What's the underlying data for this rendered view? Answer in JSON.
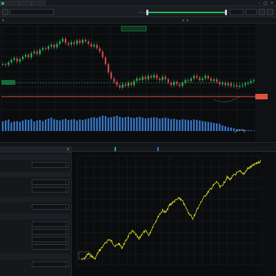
{
  "colors": {
    "background": "#0b0d10",
    "panel": "#15181b",
    "accent_green": "#1fbf5a",
    "accent_blue": "#2f7fd6",
    "candle_up": "#1fbf5a",
    "candle_down": "#d64b4b",
    "volume": "#3a78c9",
    "price_line": "#d9533f",
    "equity_line": "#e6df1f"
  },
  "icons": {
    "app": "app-logo-icon",
    "toolbar_left": "refresh-icon",
    "toolbar_right": [
      "settings-icon",
      "layout-icon",
      "close-icon"
    ],
    "panel_close": "close-icon"
  },
  "tabs": [
    {
      "label": "",
      "color": "#1fbf5a"
    },
    {
      "label": "",
      "color": "#2f7fd6"
    },
    {
      "label": "",
      "color": "#8b939c"
    }
  ],
  "toolbar": {
    "symbol": "",
    "end_value": "",
    "extra": ""
  },
  "subbar": {
    "left_label": "",
    "status": "",
    "right_label": ""
  },
  "left_panel": {
    "title": "",
    "sections": [
      {
        "name": "",
        "fields": [
          {
            "label": "",
            "value": ""
          }
        ]
      },
      {
        "name": "",
        "fields": [
          {
            "label": "",
            "value": ""
          },
          {
            "label": "",
            "value": ""
          }
        ]
      },
      {
        "name": "",
        "fields": [
          {
            "label": "",
            "value": ""
          }
        ]
      },
      {
        "name": "",
        "fields": [
          {
            "label": "",
            "value": ""
          },
          {
            "label": "",
            "value": ""
          },
          {
            "label": "",
            "value": ""
          },
          {
            "label": "",
            "value": ""
          }
        ]
      },
      {
        "name": "",
        "fields": [
          {
            "label": "",
            "value": ""
          }
        ]
      }
    ]
  },
  "bottom_tabs": [
    {
      "label": "",
      "style": "plain"
    },
    {
      "label": "",
      "style": "plain"
    },
    {
      "label": "",
      "style": "active-green"
    },
    {
      "label": "",
      "style": "plain"
    },
    {
      "label": "",
      "style": "plain"
    },
    {
      "label": "",
      "style": "plain"
    },
    {
      "label": "",
      "style": "active-blue"
    },
    {
      "label": "",
      "style": "plain"
    }
  ],
  "chart_data": [
    {
      "type": "candlestick",
      "title": "",
      "annotation": "",
      "level_labels": [
        "",
        ""
      ],
      "y_ticks": [
        "",
        "",
        "",
        "",
        "",
        "",
        "",
        "",
        ""
      ],
      "x_ticks": [
        "",
        "",
        "",
        "",
        "",
        "",
        "",
        "",
        "",
        "",
        "",
        "",
        "",
        ""
      ],
      "series": [
        {
          "values": [
            0.55,
            0.54,
            0.57,
            0.6,
            0.62,
            0.58,
            0.61,
            0.64,
            0.66,
            0.63,
            0.68,
            0.7,
            0.67,
            0.72,
            0.74,
            0.73,
            0.76,
            0.78,
            0.75,
            0.79,
            0.82,
            0.85,
            0.8,
            0.78,
            0.81,
            0.79,
            0.83,
            0.8,
            0.84,
            0.82,
            0.79,
            0.76,
            0.78,
            0.74,
            0.7,
            0.63,
            0.55,
            0.45,
            0.38,
            0.34,
            0.3,
            0.27,
            0.31,
            0.29,
            0.33,
            0.3,
            0.35,
            0.38,
            0.36,
            0.4,
            0.37,
            0.41,
            0.39,
            0.42,
            0.38,
            0.36,
            0.4,
            0.37,
            0.33,
            0.3,
            0.34,
            0.31,
            0.29,
            0.33,
            0.36,
            0.35,
            0.38,
            0.41,
            0.39,
            0.36,
            0.38,
            0.41,
            0.38,
            0.35,
            0.37,
            0.34,
            0.31,
            0.33,
            0.3,
            0.32,
            0.29,
            0.3,
            0.28,
            0.29,
            0.3,
            0.32,
            0.33,
            0.35,
            0.36
          ]
        }
      ],
      "volume": [
        0.5,
        0.55,
        0.6,
        0.45,
        0.5,
        0.52,
        0.48,
        0.55,
        0.6,
        0.58,
        0.62,
        0.5,
        0.55,
        0.58,
        0.52,
        0.6,
        0.65,
        0.7,
        0.62,
        0.58,
        0.55,
        0.6,
        0.64,
        0.58,
        0.6,
        0.62,
        0.55,
        0.6,
        0.58,
        0.62,
        0.65,
        0.7,
        0.72,
        0.68,
        0.75,
        0.8,
        0.78,
        0.7,
        0.72,
        0.76,
        0.8,
        0.74,
        0.7,
        0.72,
        0.75,
        0.7,
        0.68,
        0.72,
        0.74,
        0.7,
        0.66,
        0.68,
        0.7,
        0.72,
        0.7,
        0.65,
        0.68,
        0.7,
        0.66,
        0.62,
        0.64,
        0.6,
        0.58,
        0.62,
        0.6,
        0.58,
        0.56,
        0.6,
        0.58,
        0.55,
        0.52,
        0.5,
        0.48,
        0.45,
        0.42,
        0.4,
        0.38,
        0.3,
        0.25,
        0.2,
        0.18,
        0.15,
        0.1,
        0.08,
        0.06,
        0.05,
        0.05,
        0.04,
        0.03
      ]
    },
    {
      "type": "line",
      "title": "",
      "y_ticks": [
        "",
        "",
        "",
        "",
        "",
        "",
        "",
        "",
        "",
        ""
      ],
      "x_ticks": [
        "",
        "",
        "",
        "",
        "",
        "",
        "",
        "",
        "",
        "",
        "",
        "",
        "",
        "",
        "",
        "",
        "",
        "",
        "",
        "",
        "",
        ""
      ],
      "series": [
        {
          "values": [
            0.02,
            0.04,
            0.08,
            0.06,
            0.03,
            0.1,
            0.14,
            0.18,
            0.22,
            0.2,
            0.15,
            0.18,
            0.14,
            0.2,
            0.26,
            0.3,
            0.27,
            0.22,
            0.28,
            0.3,
            0.26,
            0.34,
            0.4,
            0.46,
            0.5,
            0.48,
            0.55,
            0.58,
            0.6,
            0.62,
            0.58,
            0.52,
            0.46,
            0.42,
            0.5,
            0.56,
            0.62,
            0.66,
            0.7,
            0.74,
            0.78,
            0.72,
            0.76,
            0.82,
            0.8,
            0.84,
            0.86,
            0.88,
            0.85,
            0.9,
            0.92,
            0.94,
            0.96,
            0.98
          ]
        }
      ]
    }
  ]
}
